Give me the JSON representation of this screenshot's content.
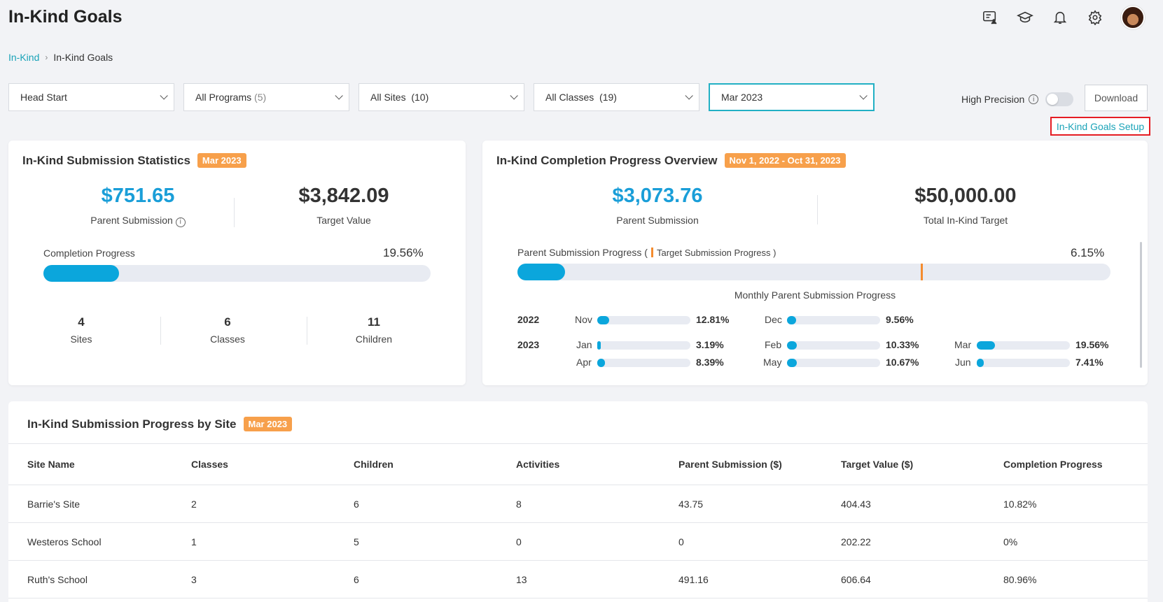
{
  "page_title": "In-Kind Goals",
  "breadcrumb": {
    "parent": "In-Kind",
    "current": "In-Kind Goals"
  },
  "filters": {
    "agency": "Head Start",
    "programs_label": "All Programs",
    "programs_count": "(5)",
    "sites_label": "All Sites",
    "sites_count": "(10)",
    "classes_label": "All Classes",
    "classes_count": "(19)",
    "month": "Mar 2023"
  },
  "precision_label": "High Precision",
  "download_label": "Download",
  "setup_link": "In-Kind Goals Setup",
  "stats_card": {
    "title": "In-Kind Submission Statistics",
    "badge": "Mar 2023",
    "parent_value": "$751.65",
    "parent_label": "Parent Submission",
    "target_value": "$3,842.09",
    "target_label": "Target Value",
    "progress_label": "Completion Progress",
    "progress_pct_text": "19.56%",
    "progress_pct": 19.56,
    "sites_num": "4",
    "sites_label": "Sites",
    "classes_num": "6",
    "classes_label": "Classes",
    "children_num": "11",
    "children_label": "Children"
  },
  "overview_card": {
    "title": "In-Kind Completion Progress Overview",
    "badge": "Nov 1, 2022 - Oct 31, 2023",
    "parent_value": "$3,073.76",
    "parent_label": "Parent Submission",
    "target_value": "$50,000.00",
    "target_label": "Total In-Kind Target",
    "progress_label": "Parent Submission Progress (",
    "target_legend": "Target Submission Progress )",
    "progress_pct_text": "6.15%",
    "progress_pct": 6.15,
    "target_pct": 68,
    "monthly_title": "Monthly Parent Submission Progress",
    "year_2022": "2022",
    "year_2023": "2023",
    "months": {
      "nov": {
        "label": "Nov",
        "pct": "12.81%",
        "value": 12.81
      },
      "dec": {
        "label": "Dec",
        "pct": "9.56%",
        "value": 9.56
      },
      "jan": {
        "label": "Jan",
        "pct": "3.19%",
        "value": 3.19
      },
      "feb": {
        "label": "Feb",
        "pct": "10.33%",
        "value": 10.33
      },
      "mar": {
        "label": "Mar",
        "pct": "19.56%",
        "value": 19.56
      },
      "apr": {
        "label": "Apr",
        "pct": "8.39%",
        "value": 8.39
      },
      "may": {
        "label": "May",
        "pct": "10.67%",
        "value": 10.67
      },
      "jun": {
        "label": "Jun",
        "pct": "7.41%",
        "value": 7.41
      }
    }
  },
  "site_table": {
    "title": "In-Kind Submission Progress by Site",
    "badge": "Mar 2023",
    "headers": [
      "Site Name",
      "Classes",
      "Children",
      "Activities",
      "Parent Submission ($)",
      "Target Value ($)",
      "Completion Progress"
    ],
    "rows": [
      [
        "Barrie's Site",
        "2",
        "6",
        "8",
        "43.75",
        "404.43",
        "10.82%"
      ],
      [
        "Westeros School",
        "1",
        "5",
        "0",
        "0",
        "202.22",
        "0%"
      ],
      [
        "Ruth's School",
        "3",
        "6",
        "13",
        "491.16",
        "606.64",
        "80.96%"
      ]
    ]
  },
  "colors": {
    "accent": "#1aa3b8",
    "progress": "#0ba6dc",
    "badge": "#f7a04b",
    "target_marker": "#f48c2f",
    "highlight_border": "#e51c23"
  },
  "icons": [
    "chat-person-icon",
    "graduation-cap-icon",
    "bell-icon",
    "gear-icon",
    "chevron-down-icon",
    "info-icon"
  ]
}
